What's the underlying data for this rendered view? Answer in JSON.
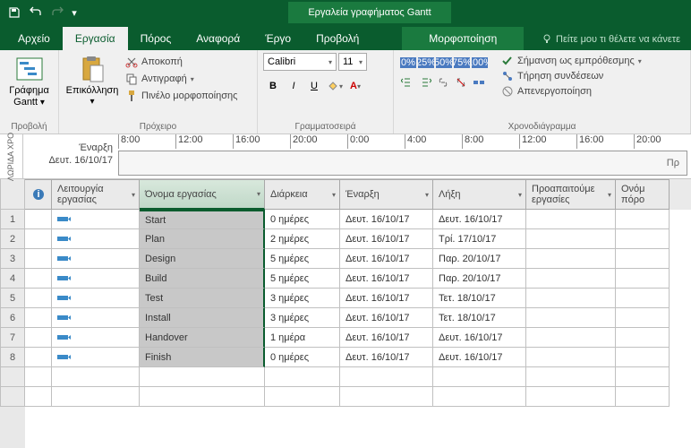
{
  "title": "Εργαλεία γραφήματος Gantt",
  "tabs": {
    "file": "Αρχείο",
    "task": "Εργασία",
    "resource": "Πόρος",
    "report": "Αναφορά",
    "project": "Έργο",
    "view": "Προβολή",
    "format": "Μορφοποίηση"
  },
  "tellme": "Πείτε μου τι θέλετε να κάνετε",
  "ribbon": {
    "view_group": "Προβολή",
    "gantt_btn": "Γράφημα\nGantt",
    "clipboard_group": "Πρόχειρο",
    "paste": "Επικόλληση",
    "cut": "Αποκοπή",
    "copy": "Αντιγραφή",
    "format_painter": "Πινέλο μορφοποίησης",
    "font_group": "Γραμματοσειρά",
    "font_name": "Calibri",
    "font_size": "11",
    "schedule_group": "Χρονοδιάγραμμα",
    "mark_ontrack": "Σήμανση ως εμπρόθεσμης",
    "respect_links": "Τήρηση συνδέσεων",
    "inactivate": "Απενεργοποίηση"
  },
  "timeline": {
    "rotate_label": "ΛΩΡΙΔΑ ΧΡΟ",
    "start_label": "Έναρξη",
    "start_date": "Δευτ. 16/10/17",
    "ticks": [
      "8:00",
      "12:00",
      "16:00",
      "20:00",
      "0:00",
      "4:00",
      "8:00",
      "12:00",
      "16:00",
      "20:00"
    ],
    "bar_text": "Πρ"
  },
  "columns": {
    "info_icon": "i",
    "mode": "Λειτουργία εργασίας",
    "name": "Όνομα εργασίας",
    "duration": "Διάρκεια",
    "start": "Έναρξη",
    "finish": "Λήξη",
    "predecessors": "Προαπαιτούμε εργασίες",
    "resources": "Ονόμ πόρο"
  },
  "rows": [
    {
      "n": "1",
      "name": "Start",
      "dur": "0 ημέρες",
      "start": "Δευτ. 16/10/17",
      "end": "Δευτ. 16/10/17"
    },
    {
      "n": "2",
      "name": "Plan",
      "dur": "2 ημέρες",
      "start": "Δευτ. 16/10/17",
      "end": "Τρί. 17/10/17"
    },
    {
      "n": "3",
      "name": "Design",
      "dur": "5 ημέρες",
      "start": "Δευτ. 16/10/17",
      "end": "Παρ. 20/10/17"
    },
    {
      "n": "4",
      "name": "Build",
      "dur": "5 ημέρες",
      "start": "Δευτ. 16/10/17",
      "end": "Παρ. 20/10/17"
    },
    {
      "n": "5",
      "name": "Test",
      "dur": "3 ημέρες",
      "start": "Δευτ. 16/10/17",
      "end": "Τετ. 18/10/17"
    },
    {
      "n": "6",
      "name": "Install",
      "dur": "3 ημέρες",
      "start": "Δευτ. 16/10/17",
      "end": "Τετ. 18/10/17"
    },
    {
      "n": "7",
      "name": "Handover",
      "dur": "1 ημέρα",
      "start": "Δευτ. 16/10/17",
      "end": "Δευτ. 16/10/17"
    },
    {
      "n": "8",
      "name": "Finish",
      "dur": "0 ημέρες",
      "start": "Δευτ. 16/10/17",
      "end": "Δευτ. 16/10/17"
    }
  ]
}
